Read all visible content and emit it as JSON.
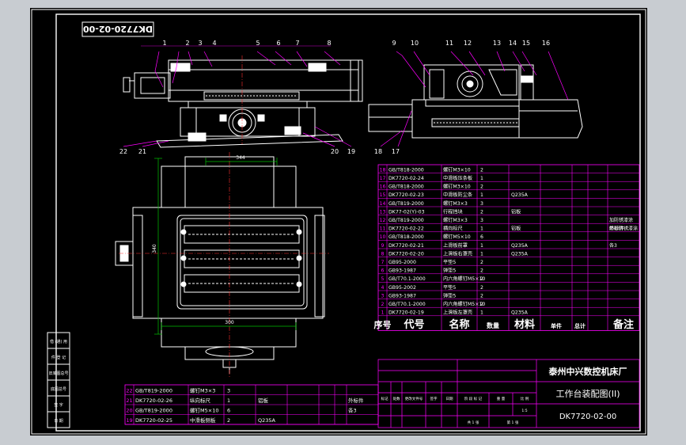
{
  "title_block": {
    "company": "泰州中兴数控机床厂",
    "drawing_title": "工作台装配图(II)",
    "drawing_no": "DK7720-02-00",
    "rotated_no": "DK7720-02-00",
    "approval_labels": [
      "标记",
      "处数",
      "更改文件号",
      "签字",
      "日期"
    ],
    "side_labels": [
      "借 (通) 用",
      "件 登 记",
      "旧底图总号",
      "底图总号",
      "签 字",
      "日 期"
    ],
    "weight_labels": [
      "阶 段 标 记",
      "重 量",
      "比 例"
    ],
    "sheet_labels": [
      "共 1 张",
      "第 1 张"
    ],
    "scale": "1:5"
  },
  "callouts_left": [
    "1",
    "2",
    "3",
    "4",
    "5",
    "6",
    "7",
    "8"
  ],
  "callouts_left_bottom": [
    "22",
    "21",
    "20",
    "19"
  ],
  "callouts_right": [
    "9",
    "10",
    "11",
    "12",
    "13",
    "14",
    "15",
    "16"
  ],
  "callouts_right_bottom": [
    "18",
    "17"
  ],
  "dimensions": {
    "top_width": "344",
    "side_height": "340",
    "bottom_width": "300"
  },
  "bom_header": {
    "no": "序号",
    "code": "代号",
    "name": "名称",
    "qty": "数量",
    "material": "材料",
    "unit_weight": "单件",
    "total_weight": "总计",
    "remarks": "备注"
  },
  "bom_rows": [
    {
      "no": "18",
      "code": "GB/T818-2000",
      "name": "螺钉M3×10",
      "qty": "2",
      "material": "",
      "remarks": ""
    },
    {
      "no": "17",
      "code": "DK7720-02-24",
      "name": "中滑板压条板",
      "qty": "1",
      "material": "",
      "remarks": ""
    },
    {
      "no": "16",
      "code": "GB/T818-2000",
      "name": "螺钉M3×10",
      "qty": "2",
      "material": "",
      "remarks": ""
    },
    {
      "no": "15",
      "code": "DK7720-02-23",
      "name": "中滑板防尘条",
      "qty": "1",
      "material": "Q235A",
      "remarks": ""
    },
    {
      "no": "14",
      "code": "GB/T819-2000",
      "name": "螺钉M3×3",
      "qty": "3",
      "material": "",
      "remarks": ""
    },
    {
      "no": "13",
      "code": "DK77-02(Y)-03",
      "name": "行程挡块",
      "qty": "2",
      "material": "铝板",
      "remarks": ""
    },
    {
      "no": "12",
      "code": "GB/T819-2000",
      "name": "螺钉M3×3",
      "qty": "3",
      "material": "",
      "remarks": ""
    },
    {
      "no": "11",
      "code": "DK7720-02-22",
      "name": "横向标尺",
      "qty": "1",
      "material": "铝板",
      "remarks": "外标件"
    },
    {
      "no": "10",
      "code": "GB/T818-2000",
      "name": "螺钉M5×10",
      "qty": "6",
      "material": "",
      "remarks": ""
    },
    {
      "no": "9",
      "code": "DK7720-02-21",
      "name": "上滑板前罩",
      "qty": "1",
      "material": "Q235A",
      "remarks": ""
    },
    {
      "no": "8",
      "code": "DK7720-02-20",
      "name": "上滑板右罩壳",
      "qty": "1",
      "material": "Q235A",
      "remarks": ""
    },
    {
      "no": "7",
      "code": "GB95-2000",
      "name": "平垫5",
      "qty": "2",
      "material": "",
      "remarks": ""
    },
    {
      "no": "6",
      "code": "GB93-1987",
      "name": "弹垫5",
      "qty": "2",
      "material": "",
      "remarks": ""
    },
    {
      "no": "5",
      "code": "GB/T70.1-2000",
      "name": "内六角螺钉M5×10",
      "qty": "2",
      "material": "",
      "remarks": ""
    },
    {
      "no": "4",
      "code": "GB95-2002",
      "name": "平垫5",
      "qty": "2",
      "material": "",
      "remarks": ""
    },
    {
      "no": "3",
      "code": "GB93-1987",
      "name": "弹垫5",
      "qty": "2",
      "material": "",
      "remarks": ""
    },
    {
      "no": "2",
      "code": "GB/T70.1-2000",
      "name": "内六角螺钉M5×10",
      "qty": "2",
      "material": "",
      "remarks": ""
    },
    {
      "no": "1",
      "code": "DK7720-02-19",
      "name": "上滑板左罩壳",
      "qty": "1",
      "material": "Q235A",
      "remarks": ""
    }
  ],
  "bom_side_notes": [
    "加防锈漆涂",
    "喷砂防锈漆涂",
    "各3"
  ],
  "bom_bottom_rows": [
    {
      "no": "22",
      "code": "GB/T819-2000",
      "name": "螺钉M3×3",
      "qty": "3",
      "material": "",
      "remarks": ""
    },
    {
      "no": "21",
      "code": "DK7720-02-26",
      "name": "纵向标尺",
      "qty": "1",
      "material": "铝板",
      "remarks": "外标件"
    },
    {
      "no": "20",
      "code": "GB/T819-2000",
      "name": "螺钉M5×10",
      "qty": "6",
      "material": "",
      "remarks": "各3"
    },
    {
      "no": "19",
      "code": "DK7720-02-25",
      "name": "中滑板侧板",
      "qty": "2",
      "material": "Q235A",
      "remarks": ""
    }
  ],
  "colors": {
    "background": "#000000",
    "frame": "#ffffff",
    "table_lines": "#ff00ff",
    "leaders": "#ff00ff",
    "annotation": "#00c000",
    "centerline": "#ff3030",
    "surround": "#c8ccd1"
  }
}
